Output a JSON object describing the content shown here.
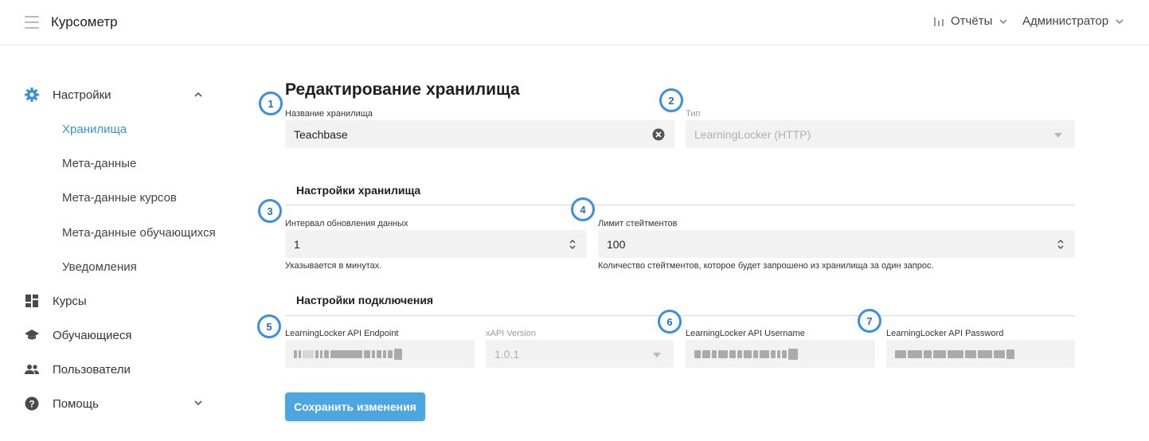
{
  "header": {
    "brand": "Курсометр",
    "reports_label": "Отчёты",
    "admin_label": "Администратор"
  },
  "sidebar": {
    "settings_label": "Настройки",
    "settings_sub": [
      "Хранилища",
      "Мета-данные",
      "Мета-данные курсов",
      "Мета-данные обучающихся",
      "Уведомления"
    ],
    "courses_label": "Курсы",
    "learners_label": "Обучающиеся",
    "users_label": "Пользователи",
    "help_label": "Помощь",
    "active_sub": "Хранилища"
  },
  "form": {
    "title": "Редактирование хранилища",
    "storage_name_label": "Название хранилища",
    "storage_name_value": "Teachbase",
    "type_label": "Тип",
    "type_value": "LearningLocker (HTTP)",
    "storage_settings_title": "Настройки хранилища",
    "interval_label": "Интервал обновления данных",
    "interval_value": "1",
    "interval_hint": "Указывается в минутах.",
    "limit_label": "Лимит стейтментов",
    "limit_value": "100",
    "limit_hint": "Количество стейтментов, которое будет запрошено из хранилища за один запрос.",
    "connection_title": "Настройки подключения",
    "endpoint_label": "LearningLocker API Endpoint",
    "xapi_label": "xAPI Version",
    "xapi_value": "1.0.1",
    "username_label": "LearningLocker API Username",
    "password_label": "LearningLocker API Password",
    "save_label": "Сохранить изменения"
  },
  "badges": [
    "1",
    "2",
    "3",
    "4",
    "5",
    "6",
    "7"
  ],
  "colors": {
    "accent": "#3d8fd6",
    "button": "#4ca6e0",
    "badge_border": "#3a8ee6",
    "field_bg": "#f2f2f2"
  }
}
